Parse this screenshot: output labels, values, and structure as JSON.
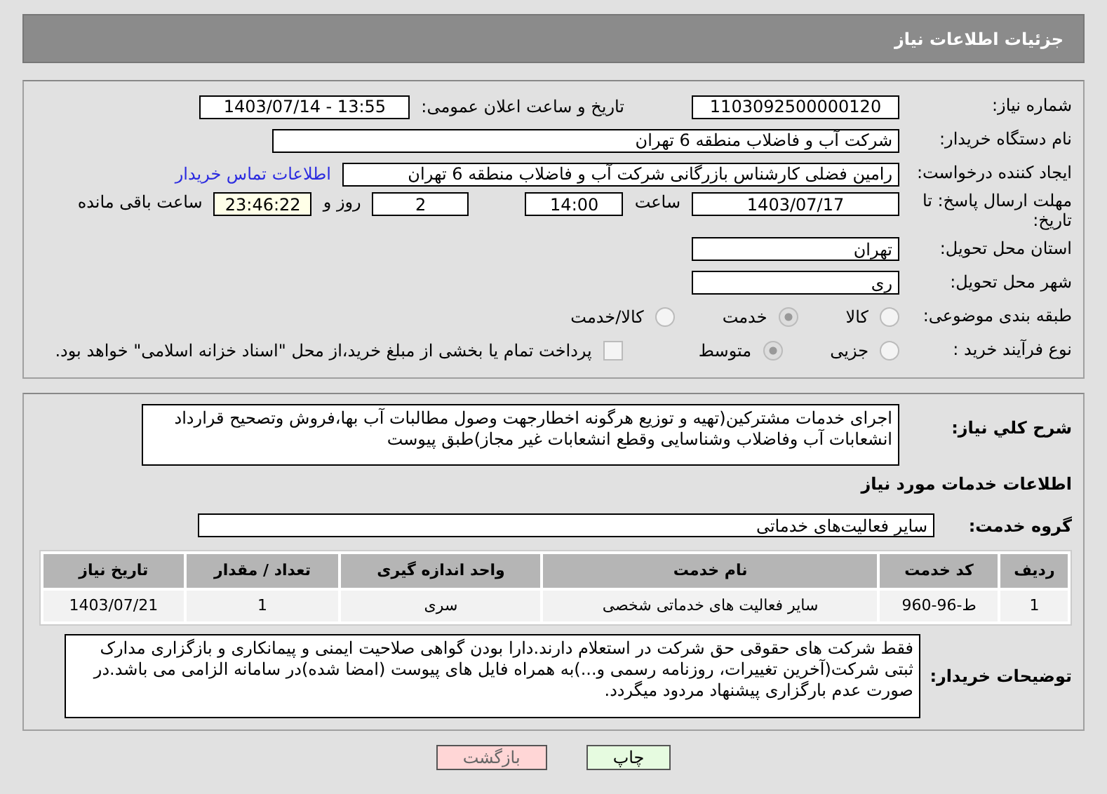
{
  "header": {
    "title": "جزئیات اطلاعات نیاز"
  },
  "need_number": {
    "label": "شماره نیاز:",
    "value": "1103092500000120"
  },
  "announce": {
    "label": "تاریخ و ساعت اعلان عمومی:",
    "value": "1403/07/14 - 13:55"
  },
  "buyer": {
    "label": "نام دستگاه خریدار:",
    "value": "شرکت آب و فاضلاب منطقه 6 تهران"
  },
  "creator": {
    "label": "ایجاد کننده درخواست:",
    "value": "رامین  فضلی کارشناس بازرگانی شرکت آب و فاضلاب منطقه 6 تهران",
    "link": "اطلاعات تماس خریدار"
  },
  "deadline": {
    "label": "مهلت ارسال پاسخ: تا تاریخ:",
    "date": "1403/07/17",
    "time_label": "ساعت",
    "time": "14:00",
    "days": "2",
    "days_label": "روز و",
    "remaining": "23:46:22",
    "remaining_label": "ساعت باقی مانده"
  },
  "province": {
    "label": "استان محل تحویل:",
    "value": "تهران"
  },
  "city": {
    "label": "شهر محل تحویل:",
    "value": "ری"
  },
  "category": {
    "label": "طبقه بندی موضوعی:",
    "options": [
      {
        "label": "کالا",
        "selected": false
      },
      {
        "label": "خدمت",
        "selected": true
      },
      {
        "label": "کالا/خدمت",
        "selected": false
      }
    ]
  },
  "process": {
    "label": "نوع فرآیند خرید :",
    "options": [
      {
        "label": "جزیی",
        "selected": false
      },
      {
        "label": "متوسط",
        "selected": true
      }
    ],
    "treasury": {
      "checked": false,
      "label": "پرداخت تمام یا بخشی از مبلغ خرید،از محل \"اسناد خزانه اسلامی\" خواهد بود."
    }
  },
  "description": {
    "label": "شرح کلي نياز:",
    "value": "اجرای خدمات مشترکین(تهیه و توزیع هرگونه اخطارجهت وصول مطالبات آب بها،فروش وتصحیح قرارداد انشعابات آب وفاضلاب وشناسایی وقطع انشعابات غیر مجاز)طبق پیوست"
  },
  "services_title": "اطلاعات خدمات مورد نیاز",
  "service_group": {
    "label": "گروه خدمت:",
    "value": "سایر فعالیت‌های خدماتی"
  },
  "table": {
    "columns": [
      "ردیف",
      "کد خدمت",
      "نام خدمت",
      "واحد اندازه گیری",
      "تعداد / مقدار",
      "تاریخ نیاز"
    ],
    "rows": [
      [
        "1",
        "ط-96-960",
        "سایر فعالیت های خدماتی شخصی",
        "سری",
        "1",
        "1403/07/21"
      ]
    ]
  },
  "buyer_notes": {
    "label": "توضیحات خریدار:",
    "value": "فقط شرکت های حقوقی حق شرکت در استعلام دارند.دارا بودن گواهی صلاحیت ایمنی و پیمانکاری و بازگزاری مدارک ثبتی شرکت(آخرین تغییرات، روزنامه رسمی و...)به همراه فایل های پیوست (امضا شده)در سامانه الزامی می باشد.در صورت عدم بارگزاری پیشنهاد مردود میگردد."
  },
  "buttons": [
    {
      "label": "چاپ",
      "kind": "print"
    },
    {
      "label": "بازگشت",
      "kind": "back"
    }
  ]
}
